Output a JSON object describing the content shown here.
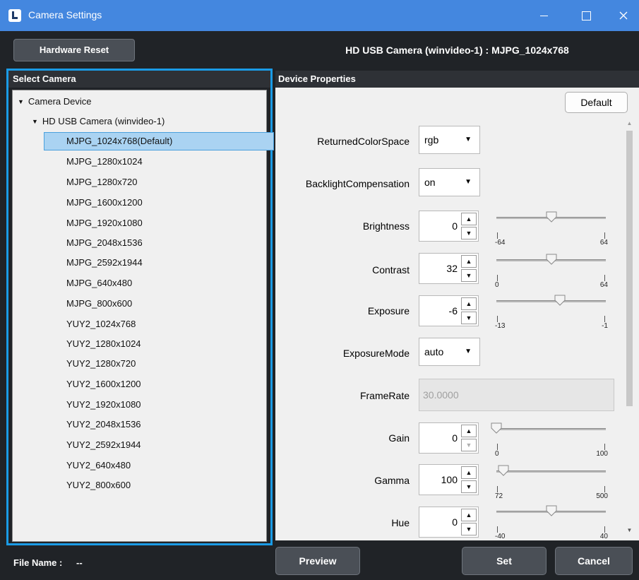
{
  "window": {
    "title": "Camera Settings",
    "accent_color": "#4487df",
    "selection_border_color": "#1a9be6"
  },
  "toolbar": {
    "hardware_reset_label": "Hardware Reset",
    "camera_heading": "HD USB Camera (winvideo-1) : MJPG_1024x768"
  },
  "left_panel": {
    "header": "Select Camera",
    "root_label": "Camera Device",
    "device_label": "HD USB Camera (winvideo-1)",
    "formats": [
      "MJPG_1024x768(Default)",
      "MJPG_1280x1024",
      "MJPG_1280x720",
      "MJPG_1600x1200",
      "MJPG_1920x1080",
      "MJPG_2048x1536",
      "MJPG_2592x1944",
      "MJPG_640x480",
      "MJPG_800x600",
      "YUY2_1024x768",
      "YUY2_1280x1024",
      "YUY2_1280x720",
      "YUY2_1600x1200",
      "YUY2_1920x1080",
      "YUY2_2048x1536",
      "YUY2_2592x1944",
      "YUY2_640x480",
      "YUY2_800x600"
    ],
    "selected_format": "MJPG_1024x768(Default)"
  },
  "right_panel": {
    "header": "Device Properties",
    "default_button": "Default",
    "properties": {
      "returned_color_space": {
        "label": "ReturnedColorSpace",
        "value": "rgb"
      },
      "backlight_compensation": {
        "label": "BacklightCompensation",
        "value": "on"
      },
      "brightness": {
        "label": "Brightness",
        "value": "0",
        "min": "-64",
        "max": "64",
        "level": 0.5
      },
      "contrast": {
        "label": "Contrast",
        "value": "32",
        "min": "0",
        "max": "64",
        "level": 0.5
      },
      "exposure": {
        "label": "Exposure",
        "value": "-6",
        "min": "-13",
        "max": "-1",
        "level": 0.583
      },
      "exposure_mode": {
        "label": "ExposureMode",
        "value": "auto"
      },
      "frame_rate": {
        "label": "FrameRate",
        "value": "30.0000"
      },
      "gain": {
        "label": "Gain",
        "value": "0",
        "min": "0",
        "max": "100",
        "level": 0.0
      },
      "gamma": {
        "label": "Gamma",
        "value": "100",
        "min": "72",
        "max": "500",
        "level": 0.065
      },
      "hue": {
        "label": "Hue",
        "value": "0",
        "min": "-40",
        "max": "40",
        "level": 0.5
      }
    }
  },
  "footer": {
    "file_name_label": "File Name :",
    "file_name_value": "--",
    "preview_label": "Preview",
    "set_label": "Set",
    "cancel_label": "Cancel"
  }
}
